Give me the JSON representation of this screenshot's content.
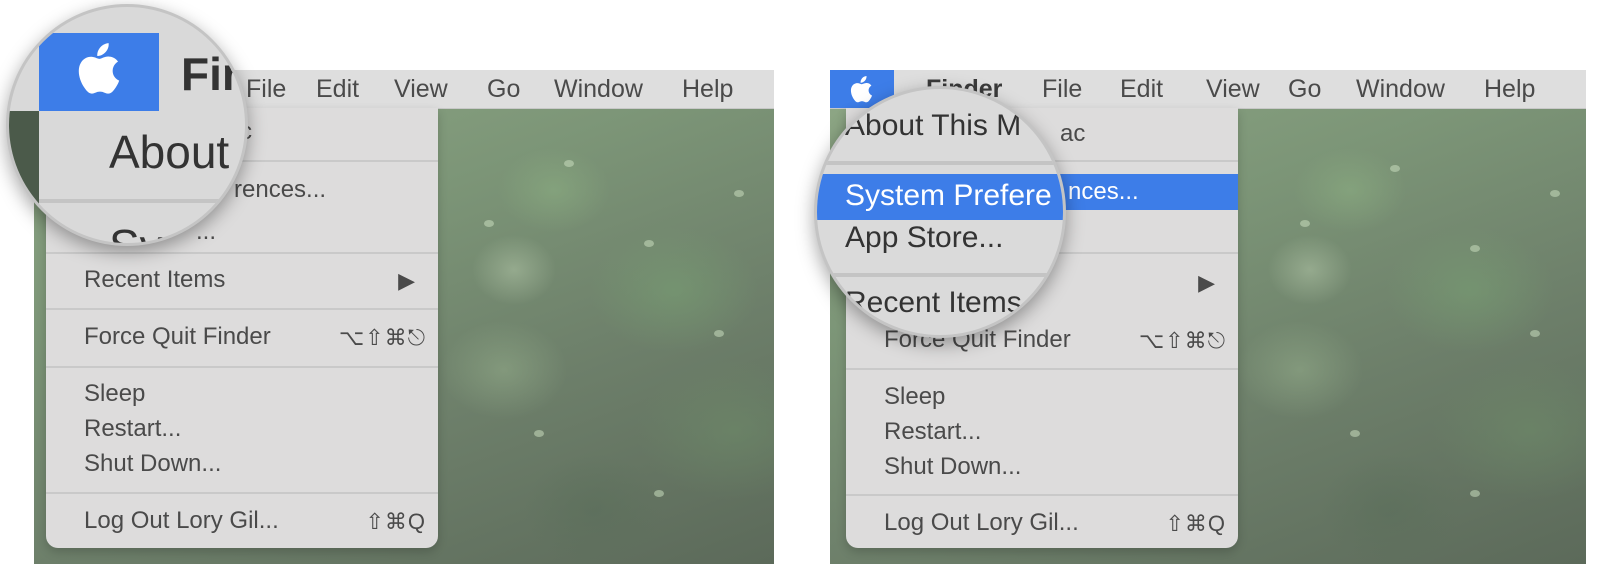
{
  "menubar": {
    "app_name": "Finder",
    "items": [
      "File",
      "Edit",
      "View",
      "Go",
      "Window",
      "Help"
    ],
    "apple_icon": "apple-logo-icon",
    "highlight_color": "#3d7de8"
  },
  "left": {
    "menu_about_fragment": "c",
    "menu_prefs_fragment": "rences...",
    "menu_sys_fragment": "...",
    "menu_items": [
      {
        "label": "Recent Items",
        "shortcut": "▶"
      },
      {
        "label": "Force Quit Finder",
        "shortcut": "⌥⇧⌘⎋"
      },
      {
        "label": "Sleep",
        "shortcut": ""
      },
      {
        "label": "Restart...",
        "shortcut": ""
      },
      {
        "label": "Shut Down...",
        "shortcut": ""
      },
      {
        "label": "Log Out Lory Gil...",
        "shortcut": "⇧⌘Q"
      }
    ],
    "magnifier": {
      "finder_fragment": "Fir",
      "about_fragment": "About",
      "sys_fragment": "Sys"
    }
  },
  "right": {
    "menubar_finder_fragment": "Finder",
    "menu_about_fragment": "ac",
    "menu_prefs_fragment": "nces...",
    "menu_items": [
      {
        "label": "Force Quit Finder",
        "shortcut": "⌥⇧⌘⎋"
      },
      {
        "label": "Sleep",
        "shortcut": ""
      },
      {
        "label": "Restart...",
        "shortcut": ""
      },
      {
        "label": "Shut Down...",
        "shortcut": ""
      },
      {
        "label": "Log Out Lory Gil...",
        "shortcut": "⇧⌘Q"
      }
    ],
    "recent_arrow": "▶",
    "magnifier": {
      "about": "About This M",
      "system_prefs": "System Prefere",
      "app_store": "App Store...",
      "recent": "Recent Items"
    }
  }
}
